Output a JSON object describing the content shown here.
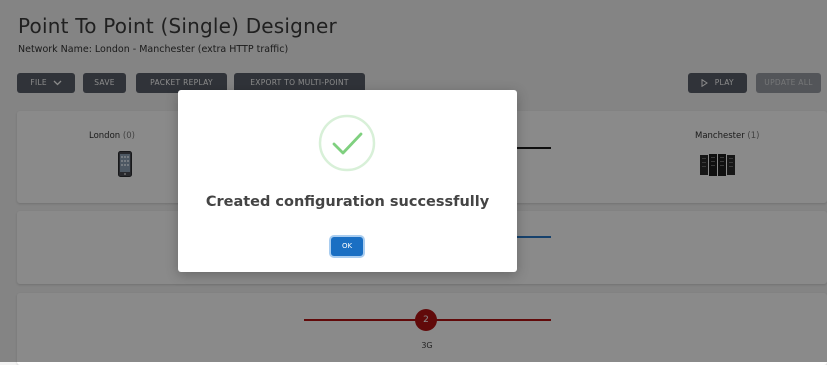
{
  "page": {
    "title": "Point To Point (Single) Designer",
    "network_name": "Network Name: London - Manchester (extra HTTP traffic)"
  },
  "toolbar": {
    "file_label": "FILE",
    "save_label": "SAVE",
    "packet_replay_label": "PACKET REPLAY",
    "export_label": "EXPORT TO MULTI-POINT",
    "play_label": "PLAY",
    "update_all_label": "UPDATE ALL"
  },
  "nodes": {
    "left": {
      "name": "London",
      "count": "(0)",
      "icon": "mobile-phone-icon"
    },
    "right": {
      "name": "Manchester",
      "count": "(1)",
      "icon": "server-rack-icon"
    }
  },
  "links": [
    {
      "color": "#1c1c1c"
    },
    {
      "color": "#2a78c8"
    },
    {
      "color": "#b31414",
      "badge": "2",
      "label": "3G"
    }
  ],
  "modal": {
    "message": "Created configuration successfully",
    "ok_label": "OK",
    "icon": "checkmark-circle-icon",
    "accent": "#7fd07f"
  },
  "colors": {
    "toolbar_button": "#595f69",
    "primary": "#1a6fc3",
    "danger": "#b31414"
  }
}
